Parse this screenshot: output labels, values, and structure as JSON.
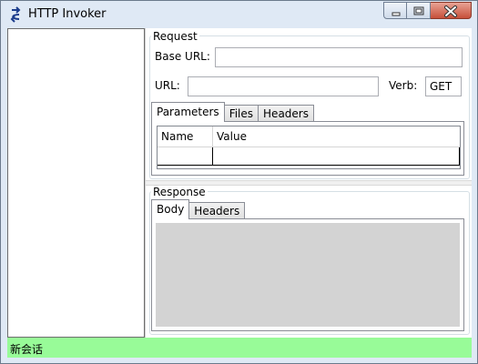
{
  "window": {
    "title": "HTTP Invoker"
  },
  "request": {
    "group_label": "Request",
    "base_url_label": "Base URL:",
    "base_url_value": "",
    "url_label": "URL:",
    "url_value": "",
    "verb_label": "Verb:",
    "verb_value": "GET",
    "tabs": [
      {
        "label": "Parameters",
        "active": true
      },
      {
        "label": "Files",
        "active": false
      },
      {
        "label": "Headers",
        "active": false
      }
    ],
    "grid": {
      "columns": [
        "Name",
        "Value"
      ],
      "rows": [
        [
          "",
          ""
        ]
      ]
    }
  },
  "response": {
    "group_label": "Response",
    "tabs": [
      {
        "label": "Body",
        "active": true
      },
      {
        "label": "Headers",
        "active": false
      }
    ]
  },
  "statusbar": {
    "text": "新会话"
  },
  "colors": {
    "statusbar_bg": "#98fb98",
    "body_area_bg": "#d3d3d3",
    "close_button": "#c7503a"
  },
  "icons": {
    "app": "bidirectional-arrows-icon",
    "minimize": "minimize-icon",
    "maximize": "maximize-icon",
    "close": "close-icon"
  }
}
